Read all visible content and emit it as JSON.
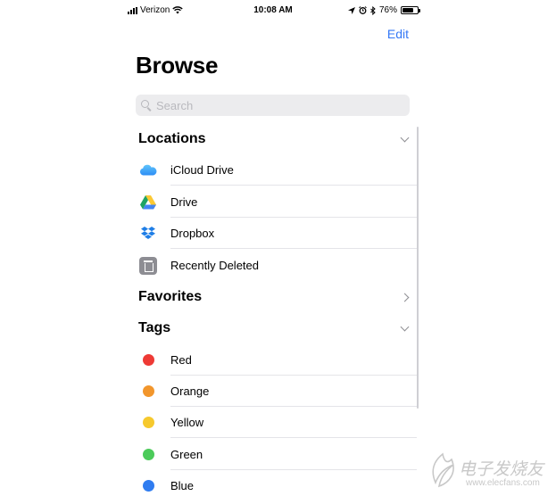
{
  "status_bar": {
    "carrier": "Verizon",
    "time": "10:08 AM",
    "battery_percent": "76%",
    "battery_level": 0.76,
    "icons": [
      "signal-icon",
      "wifi-icon",
      "location-icon",
      "alarm-icon",
      "bluetooth-icon",
      "battery-icon"
    ]
  },
  "header": {
    "edit_label": "Edit",
    "title": "Browse"
  },
  "search": {
    "placeholder": "Search",
    "value": ""
  },
  "locations": {
    "header": "Locations",
    "items": [
      {
        "label": "iCloud Drive",
        "icon": "icloud-drive-icon"
      },
      {
        "label": "Drive",
        "icon": "google-drive-icon"
      },
      {
        "label": "Dropbox",
        "icon": "dropbox-icon"
      },
      {
        "label": "Recently Deleted",
        "icon": "trash-icon"
      }
    ]
  },
  "favorites": {
    "header": "Favorites"
  },
  "tags": {
    "header": "Tags",
    "items": [
      {
        "label": "Red",
        "color": "#ee3a35"
      },
      {
        "label": "Orange",
        "color": "#f2962c"
      },
      {
        "label": "Yellow",
        "color": "#f6c92d"
      },
      {
        "label": "Green",
        "color": "#4ccb5a"
      },
      {
        "label": "Blue",
        "color": "#2f7cf0"
      }
    ]
  },
  "colors": {
    "accent": "#3478f6"
  },
  "watermark": {
    "text": "电子发烧友",
    "url": "www.elecfans.com"
  }
}
